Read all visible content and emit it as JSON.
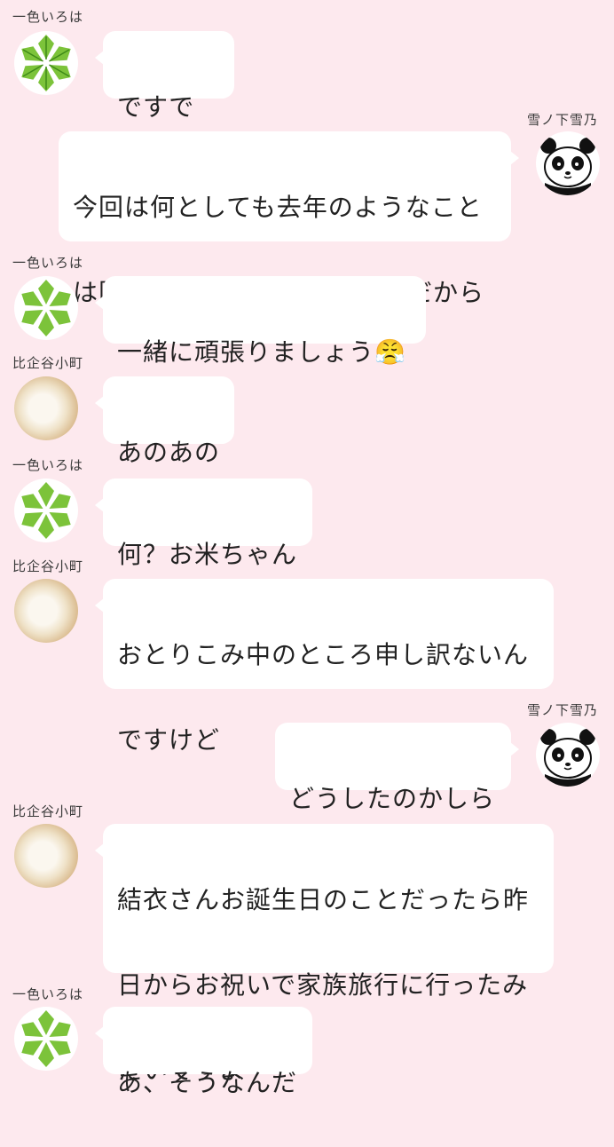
{
  "messages": [
    {
      "side": "left",
      "sender": "一色いろは",
      "avatar": "green-leaf-icon",
      "lines": [
        "ですです"
      ]
    },
    {
      "side": "right",
      "sender": "雪ノ下雪乃",
      "avatar": "panda-icon",
      "lines": [
        "今回は何としても去年のようなこと",
        "は阻止しなければならないのだから"
      ]
    },
    {
      "side": "left",
      "sender": "一色いろは",
      "avatar": "green-leaf-icon",
      "lines": [
        "一緒に頑張りましょう😤"
      ]
    },
    {
      "side": "left",
      "sender": "比企谷小町",
      "avatar": "rice-icon",
      "lines": [
        "あのあの"
      ]
    },
    {
      "side": "left",
      "sender": "一色いろは",
      "avatar": "green-leaf-icon",
      "lines": [
        "何？お米ちゃん"
      ]
    },
    {
      "side": "left",
      "sender": "比企谷小町",
      "avatar": "rice-icon",
      "lines": [
        "おとりこみ中のところ申し訳ないん",
        "ですけど"
      ]
    },
    {
      "side": "right",
      "sender": "雪ノ下雪乃",
      "avatar": "panda-icon",
      "lines": [
        "どうしたのかしら"
      ]
    },
    {
      "side": "left",
      "sender": "比企谷小町",
      "avatar": "rice-icon",
      "lines": [
        "結衣さんお誕生日のことだったら昨",
        "日からお祝いで家族旅行に行ったみ",
        "たいですよ"
      ]
    },
    {
      "side": "left",
      "sender": "一色いろは",
      "avatar": "green-leaf-icon",
      "lines": [
        "あ、そうなんだ"
      ]
    }
  ],
  "colors": {
    "background": "#fde9ee",
    "bubble": "#ffffff",
    "leaf": "#7cc33a"
  }
}
